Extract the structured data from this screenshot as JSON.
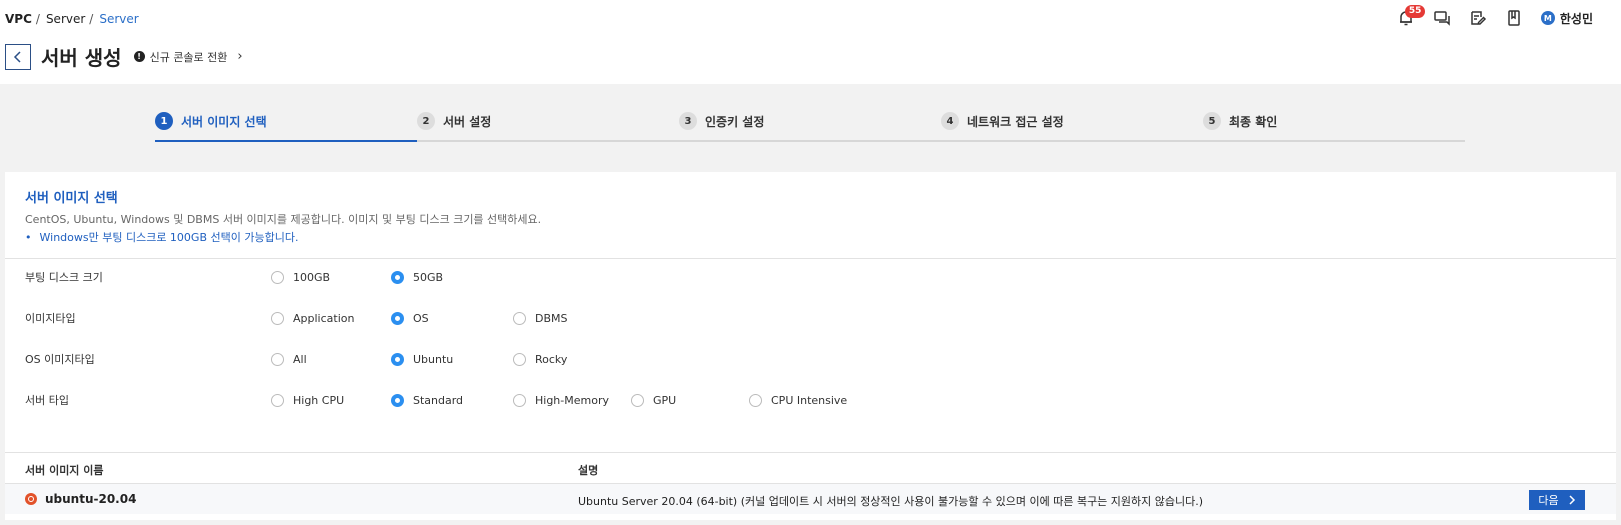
{
  "breadcrumb": {
    "vpc": "VPC",
    "server": "Server",
    "current": "Server",
    "sep": "/"
  },
  "header": {
    "notification_count": "55",
    "user_initial": "M",
    "user_name": "한성민"
  },
  "title": {
    "text": "서버 생성",
    "switch_label": "신규 콘솔로 전환",
    "info_glyph": "!",
    "chevron": "›"
  },
  "steps": [
    {
      "num": "1",
      "label": "서버 이미지 선택"
    },
    {
      "num": "2",
      "label": "서버 설정"
    },
    {
      "num": "3",
      "label": "인증키 설정"
    },
    {
      "num": "4",
      "label": "네트워크 접근 설정"
    },
    {
      "num": "5",
      "label": "최종 확인"
    }
  ],
  "section": {
    "title": "서버 이미지 선택",
    "desc": "CentOS, Ubuntu, Windows 및 DBMS 서버 이미지를 제공합니다. 이미지 및 부팅 디스크 크기를 선택하세요.",
    "note": "Windows만 부팅 디스크로 100GB 선택이 가능합니다."
  },
  "options": {
    "boot_disk": {
      "label": "부팅 디스크 크기",
      "choices": [
        "100GB",
        "50GB"
      ],
      "selected": "50GB"
    },
    "image_type": {
      "label": "이미지타입",
      "choices": [
        "Application",
        "OS",
        "DBMS"
      ],
      "selected": "OS"
    },
    "os_image_type": {
      "label": "OS 이미지타입",
      "choices": [
        "All",
        "Ubuntu",
        "Rocky"
      ],
      "selected": "Ubuntu"
    },
    "server_type": {
      "label": "서버 타입",
      "choices": [
        "High CPU",
        "Standard",
        "High-Memory",
        "GPU",
        "CPU Intensive"
      ],
      "selected": "Standard"
    }
  },
  "table": {
    "headers": [
      "서버 이미지 이름",
      "설명"
    ],
    "rows": [
      {
        "name": "ubuntu-20.04",
        "desc": "Ubuntu Server 20.04 (64-bit) (커널 업데이트 시 서버의 정상적인 사용이 불가능할 수 있으며 이에 따른 복구는 지원하지 않습니다.)",
        "action": "다음"
      }
    ]
  },
  "colors": {
    "accent": "#1f5fbf",
    "radio": "#2b8ff0",
    "badge": "#e53935",
    "ubuntu": "#e2522a"
  }
}
